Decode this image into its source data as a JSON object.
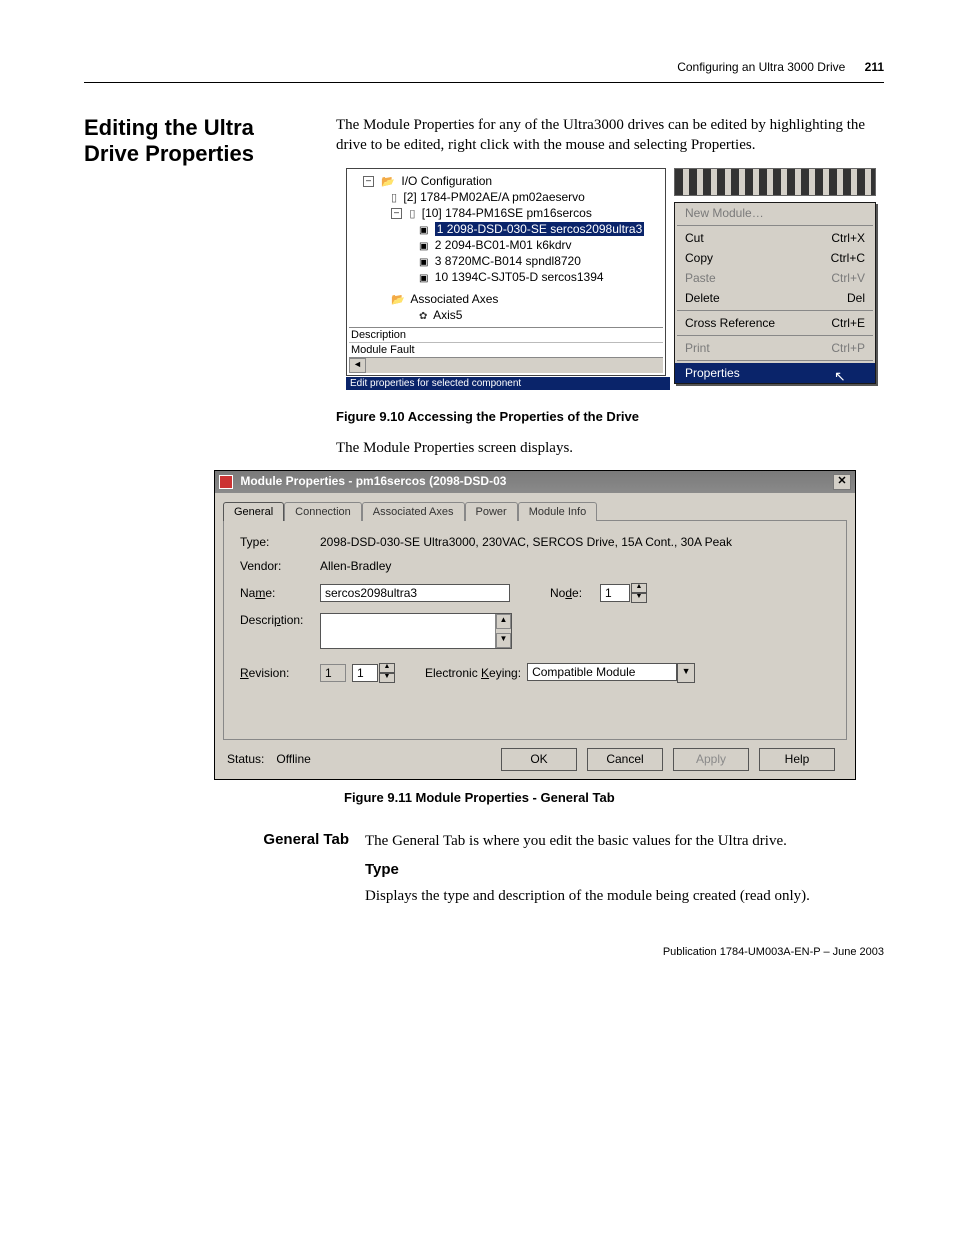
{
  "running_head": {
    "chapter": "Configuring an Ultra 3000 Drive",
    "page": "211"
  },
  "heading": "Editing the Ultra Drive Properties",
  "intro": "The Module Properties for any of the Ultra3000 drives can be edited by highlighting the drive to be edited, right click with the mouse and selecting Properties.",
  "tree": {
    "root": "I/O Configuration",
    "node_a": "[2] 1784-PM02AE/A pm02aeservo",
    "node_b": "[10] 1784-PM16SE pm16sercos",
    "child1": "1 2098-DSD-030-SE sercos2098ultra3",
    "child2": "2 2094-BC01-M01 k6kdrv",
    "child3": "3 8720MC-B014 spndl8720",
    "child4": "10 1394C-SJT05-D sercos1394",
    "assoc": "Associated Axes",
    "axis": "Axis5",
    "desc_lbl": "Description",
    "fault_lbl": "Module Fault",
    "hint": "Edit properties for selected component"
  },
  "menu": {
    "new_module": "New Module…",
    "cut": "Cut",
    "cut_k": "Ctrl+X",
    "copy": "Copy",
    "copy_k": "Ctrl+C",
    "paste": "Paste",
    "paste_k": "Ctrl+V",
    "delete": "Delete",
    "delete_k": "Del",
    "xref": "Cross Reference",
    "xref_k": "Ctrl+E",
    "print": "Print",
    "print_k": "Ctrl+P",
    "props": "Properties"
  },
  "fig910_caption": "Figure 9.10 Accessing the Properties of the Drive",
  "after_fig910": "The Module Properties screen displays.",
  "dlg": {
    "title": "Module Properties - pm16sercos (2098-DSD-03",
    "tabs": {
      "general": "General",
      "connection": "Connection",
      "assoc": "Associated Axes",
      "power": "Power",
      "modinfo": "Module Info"
    },
    "type_lbl": "Type:",
    "type_val": "2098-DSD-030-SE Ultra3000, 230VAC, SERCOS Drive, 15A Cont., 30A Peak",
    "vendor_lbl": "Vendor:",
    "vendor_val": "Allen-Bradley",
    "name_lbl": "Name:",
    "name_val": "sercos2098ultra3",
    "node_lbl": "Node:",
    "node_val": "1",
    "desc_lbl": "Description:",
    "rev_lbl": "Revision:",
    "rev_major": "1",
    "rev_minor": "1",
    "ek_lbl": "Electronic Keying:",
    "ek_val": "Compatible Module",
    "status_lbl": "Status:",
    "status_val": "Offline",
    "ok": "OK",
    "cancel": "Cancel",
    "apply": "Apply",
    "help": "Help"
  },
  "fig911_caption": "Figure 9.11 Module Properties - General Tab",
  "general_tab_sidehead": "General Tab",
  "general_tab_body": "The General Tab is where you edit the basic values for the Ultra drive.",
  "type_sub": "Type",
  "type_body": "Displays the type and description of the module being created (read only).",
  "pubnote": "Publication 1784-UM003A-EN-P – June 2003"
}
